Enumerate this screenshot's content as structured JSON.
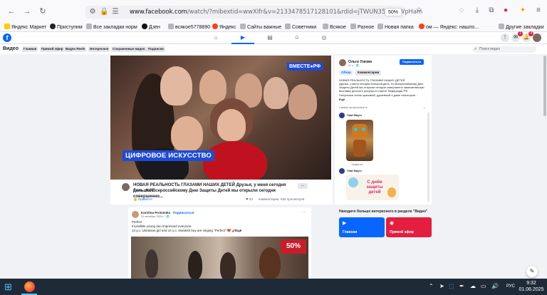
{
  "browser": {
    "url_host": "www.facebook.com",
    "url_rest": "/watch/?mibextid=wwXIfr&v=2133478517128101&rdid=jTWUN35nS9fWpHam",
    "zoom": "50%"
  },
  "bookmarks": [
    {
      "label": "Яндекс Маркет",
      "color": "#ffcc00"
    },
    {
      "label": "Приступим",
      "color": "#222222"
    },
    {
      "label": "Все закладки норм",
      "color": "#555555"
    },
    {
      "label": "Дзен",
      "color": "#111111"
    },
    {
      "label": "всякое5778890",
      "color": "#555555"
    },
    {
      "label": "Яндекс",
      "color": "#fc3f1d"
    },
    {
      "label": "Сайты важные",
      "color": "#555555"
    },
    {
      "label": "Советники",
      "color": "#555555"
    },
    {
      "label": "Всякое",
      "color": "#555555"
    },
    {
      "label": "Разное",
      "color": "#555555"
    },
    {
      "label": "Новая папка",
      "color": "#555555"
    },
    {
      "label": "ом — Яндекс: нашло...",
      "color": "#fc3f1d"
    },
    {
      "label": "Другие закладки",
      "color": "#555555"
    }
  ],
  "fb_header": {
    "logo": "f",
    "notif_count": "4"
  },
  "video_bar": {
    "title": "Видео",
    "tabs": [
      "Главная",
      "Прямой эфир",
      "Видео Reels",
      "Интересное",
      "Сохраненные видео",
      "Подписки"
    ],
    "search_placeholder": "Поиск видео"
  },
  "main_post": {
    "brand_tag": "ВМЕСТЕ●РФ",
    "caption": "ЦИФРОВОЕ ИСКУССТВО",
    "title_line1": "НОВАЯ РЕАЛЬНОСТЬ ГЛАЗАМИ НАШИХ ДЕТЕЙ Друзья, у меня сегодня большой",
    "title_line2": "день. Ко Всероссийскому Дню Защиты Детей мы открыли сегодня совершенно...",
    "more": "...",
    "like": "Нравится",
    "comment": "Комментарии",
    "views": "626 просмотров",
    "reactions": "53"
  },
  "side_panel": {
    "author": "Ольга Узкова",
    "time": "11 ч. · 🌐",
    "subscribe": "Подписаться",
    "tab_overview": "Обзор",
    "tab_comments": "Комментарии",
    "text_lines": [
      "НОВАЯ РЕАЛЬНОСТЬ ГЛАЗАМИ НАШИХ ДЕТЕЙ",
      "Друзья, у меня сегодня большой день. Ко Всероссийскому Дню",
      "Защиты Детей мы открыли сегодня совершенно замечательную",
      "выставку детского рисунка в Совете Федерации РФ.",
      "Получился очень красивый, душевный и даже некоторые...",
      "Ещё"
    ],
    "rec_label": "Самые актуальные ▾",
    "rec1_name": "Vlad Mayer",
    "rec1_stats": "Нравится",
    "rec2_name": "Vlad Mayer",
    "rec2_overlay": "С днём защиты детей"
  },
  "post2": {
    "author": "Karolina Protsenko",
    "follow": "Подписаться",
    "date": "24 сентября, 2024 г. · 🌐",
    "line1": "Perfect",
    "line2": "Incredible young duo impressed everyone",
    "line3": "13 y.o. Ukrainian girl and 14 y.o. Swedish boy are singing \"Perfect\" ❤️ 🎻...",
    "line4": "Ещё",
    "sign": "50%"
  },
  "discover": {
    "title": "Находите больше интересного в разделе \"Видео\"",
    "card1": "Главная",
    "card2": "Прямой эфир",
    "card1_color": "#0866ff",
    "card2_color": "#e41e3f"
  },
  "taskbar": {
    "lang": "РУС",
    "time": "9:32",
    "date": "01.06.2025"
  }
}
